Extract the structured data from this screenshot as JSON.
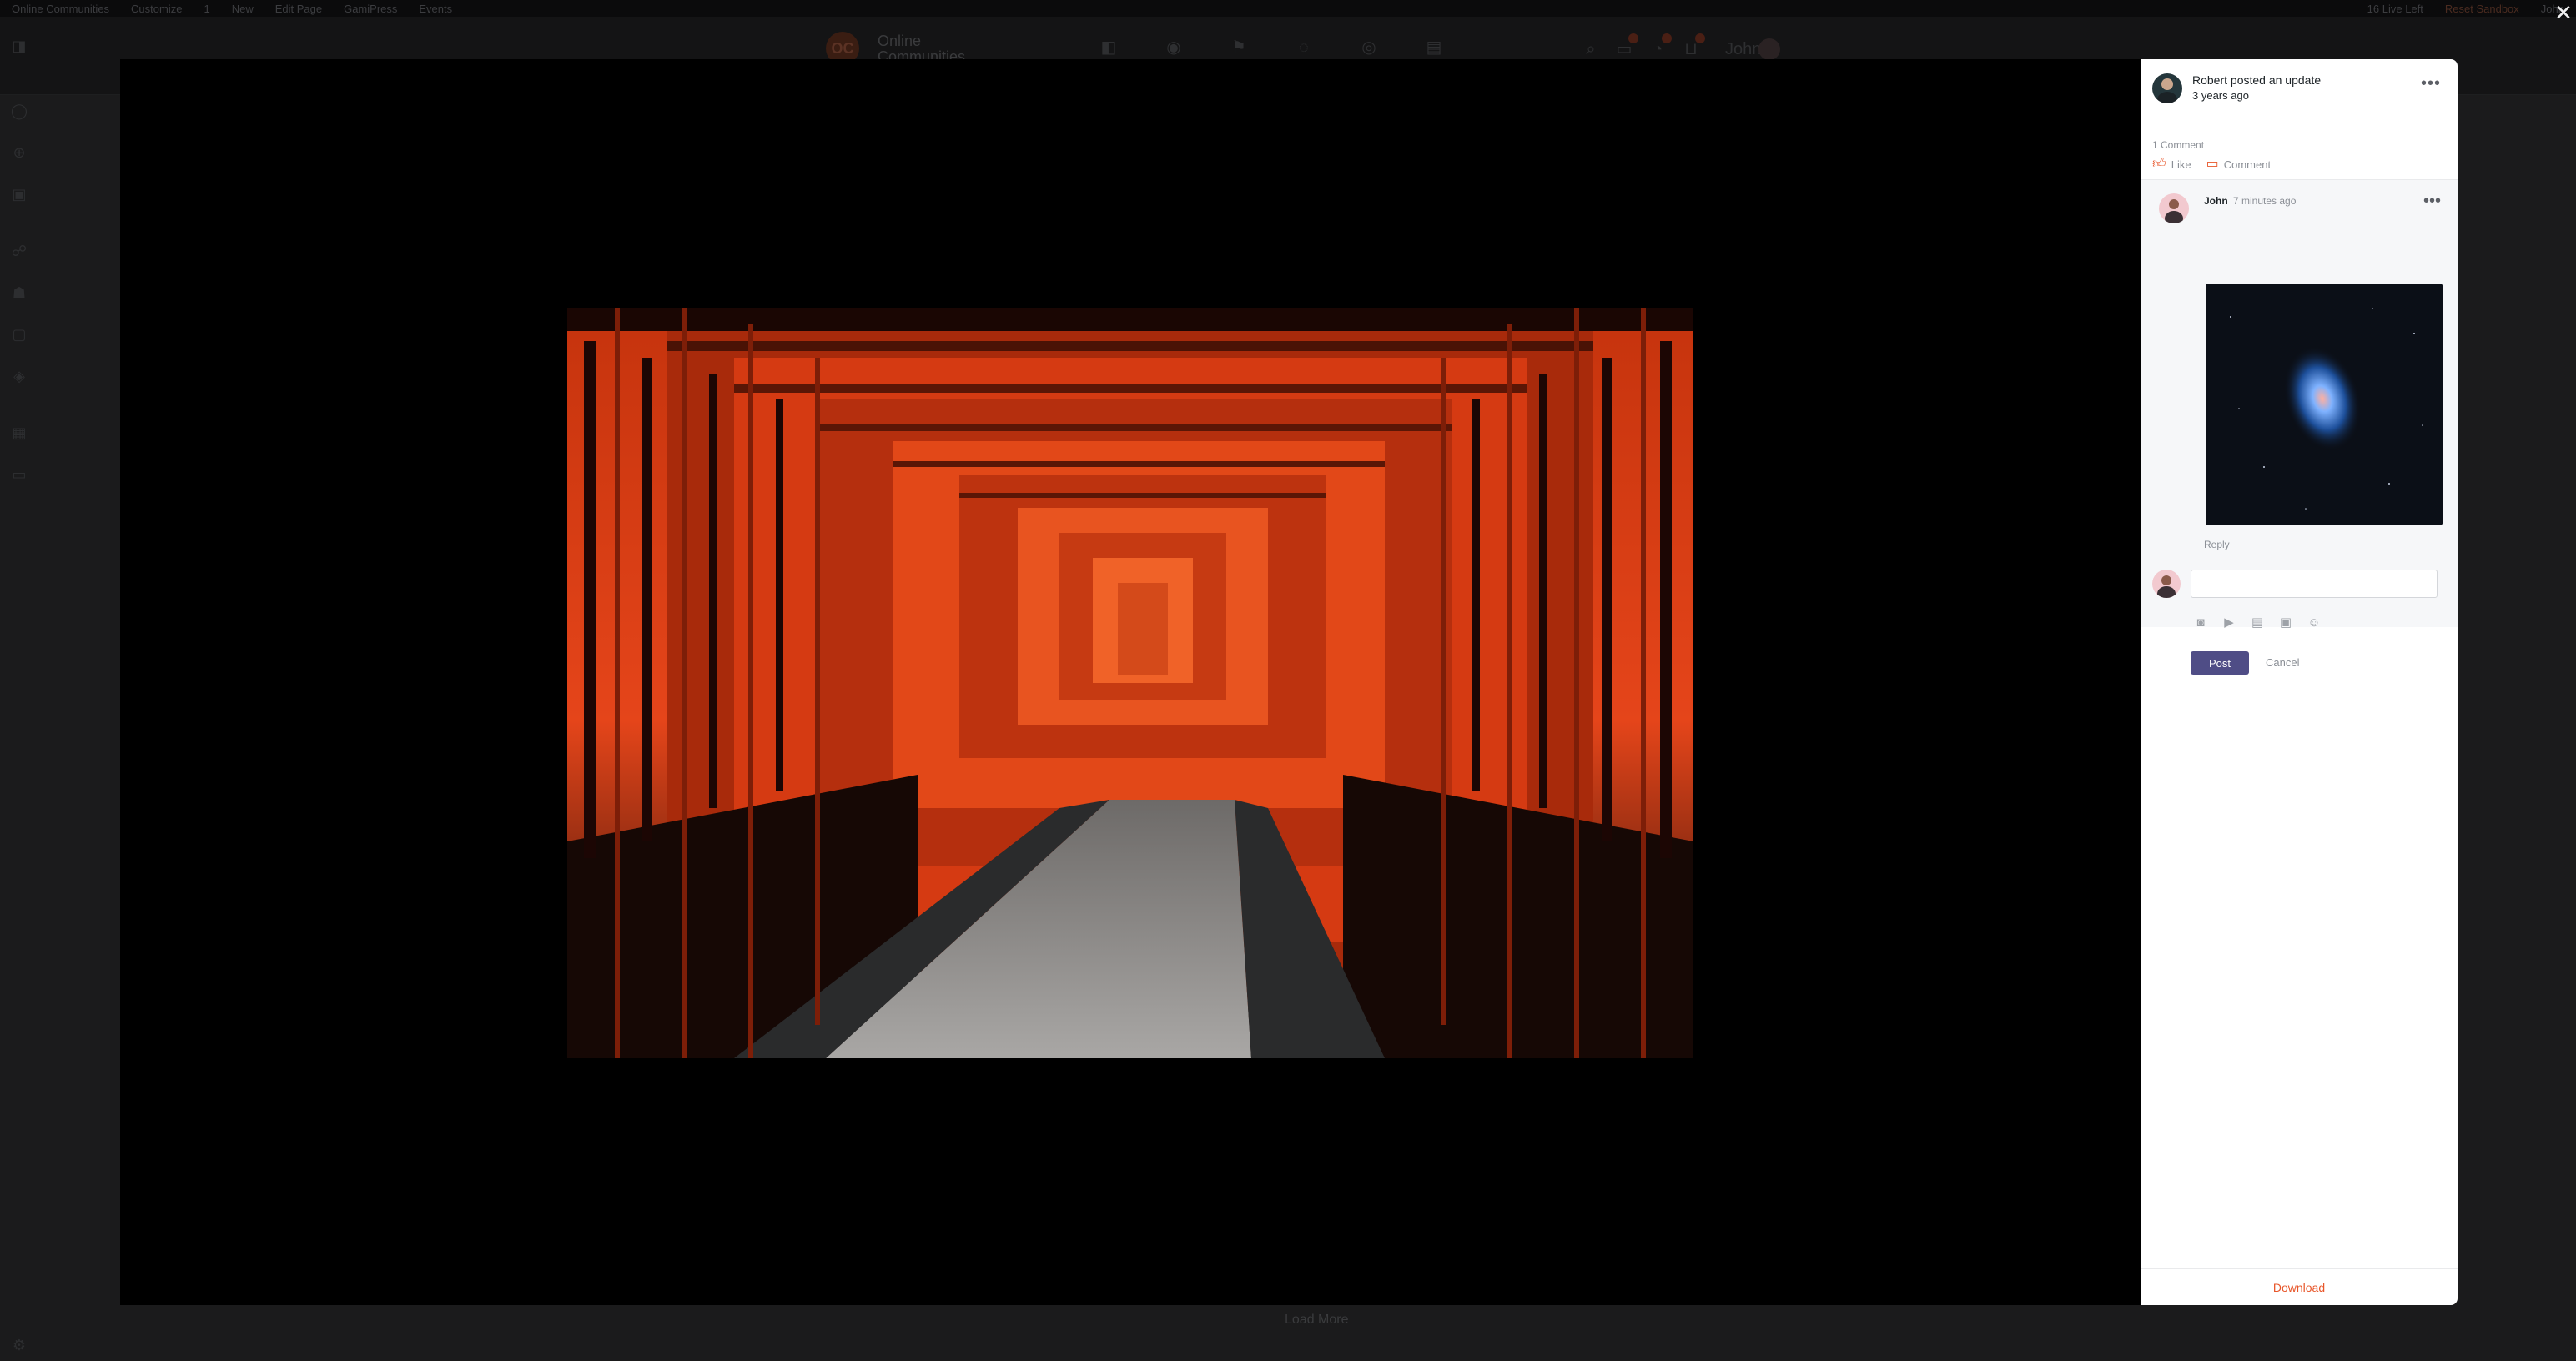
{
  "admin_bar": {
    "items": [
      "Online Communities",
      "Customize",
      "1",
      "New",
      "Edit Page",
      "GamiPress",
      "Events"
    ],
    "right": [
      "16 Live Left",
      "Reset Sandbox",
      "John"
    ]
  },
  "site": {
    "logo_text": "OC",
    "name": "Online Communities",
    "user_name": "John"
  },
  "page": {
    "load_more_label": "Load More"
  },
  "lightbox": {
    "close_glyph": "✕",
    "post": {
      "author_line": "Robert posted an update",
      "time": "3 years ago",
      "menu_glyph": "•••",
      "comment_count": "1 Comment",
      "like_label": "Like",
      "comment_label": "Comment"
    },
    "comment": {
      "author": "John",
      "time": "7 minutes ago",
      "menu_glyph": "•••",
      "reply_label": "Reply"
    },
    "reply_form": {
      "placeholder": "",
      "post_label": "Post",
      "cancel_label": "Cancel"
    },
    "download_label": "Download"
  },
  "colors": {
    "accent": "#e8562a",
    "post_button": "#4f4d86",
    "overlay": "#1b1b1c"
  }
}
